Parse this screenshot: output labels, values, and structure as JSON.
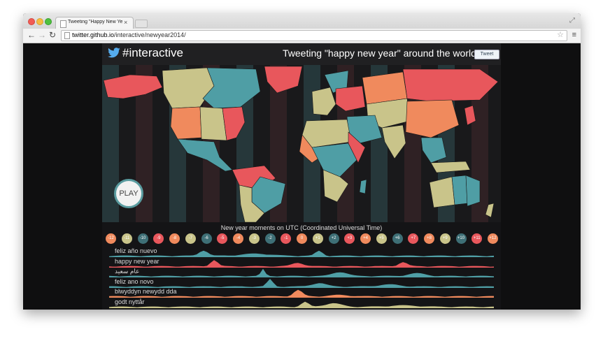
{
  "browser": {
    "tab_title": "Tweeting \"Happy New Yea",
    "url_host": "twitter.github.io",
    "url_path": "/interactive/newyear2014/"
  },
  "site": {
    "brand": "#interactive",
    "headline": "Tweeting \"happy new year\" around the world",
    "tweet_button": "Tweet",
    "play_label": "PLAY",
    "timezone_title": "New year moments on UTC (Coordinated Universal Time)"
  },
  "colors": {
    "red": "#e8575c",
    "orange": "#f08a5d",
    "khaki": "#c9c48a",
    "teal": "#4f9ea5",
    "tealdark": "#3e6f76"
  },
  "timezones": [
    {
      "label": "-12",
      "color": "#f08a5d"
    },
    {
      "label": "-11",
      "color": "#c9c48a"
    },
    {
      "label": "-10",
      "color": "#3e6f76"
    },
    {
      "label": "-9",
      "color": "#e8575c"
    },
    {
      "label": "-8",
      "color": "#f08a5d"
    },
    {
      "label": "-7",
      "color": "#c9c48a"
    },
    {
      "label": "-6",
      "color": "#3e6f76"
    },
    {
      "label": "-5",
      "color": "#e8575c"
    },
    {
      "label": "-4",
      "color": "#f08a5d"
    },
    {
      "label": "-3",
      "color": "#c9c48a"
    },
    {
      "label": "-2",
      "color": "#3e6f76"
    },
    {
      "label": "-1",
      "color": "#e8575c"
    },
    {
      "label": "0",
      "color": "#f08a5d"
    },
    {
      "label": "+1",
      "color": "#c9c48a"
    },
    {
      "label": "+2",
      "color": "#3e6f76"
    },
    {
      "label": "+3",
      "color": "#e8575c"
    },
    {
      "label": "+4",
      "color": "#f08a5d"
    },
    {
      "label": "+5",
      "color": "#c9c48a"
    },
    {
      "label": "+6",
      "color": "#3e6f76"
    },
    {
      "label": "+7",
      "color": "#e8575c"
    },
    {
      "label": "+8",
      "color": "#f08a5d"
    },
    {
      "label": "+9",
      "color": "#c9c48a"
    },
    {
      "label": "+10",
      "color": "#3e6f76"
    },
    {
      "label": "+11",
      "color": "#e8575c"
    },
    {
      "label": "+12",
      "color": "#f08a5d"
    }
  ],
  "streams": [
    {
      "label": "feliz año nuevo",
      "color": "#4f9ea5"
    },
    {
      "label": "happy new year",
      "color": "#e8575c"
    },
    {
      "label": "عام سعيد",
      "color": "#4f9ea5"
    },
    {
      "label": "feliz ano novo",
      "color": "#4f9ea5"
    },
    {
      "label": "blwyddyn newydd dda",
      "color": "#f08a5d"
    },
    {
      "label": "godt nyttår",
      "color": "#c9c48a"
    }
  ]
}
